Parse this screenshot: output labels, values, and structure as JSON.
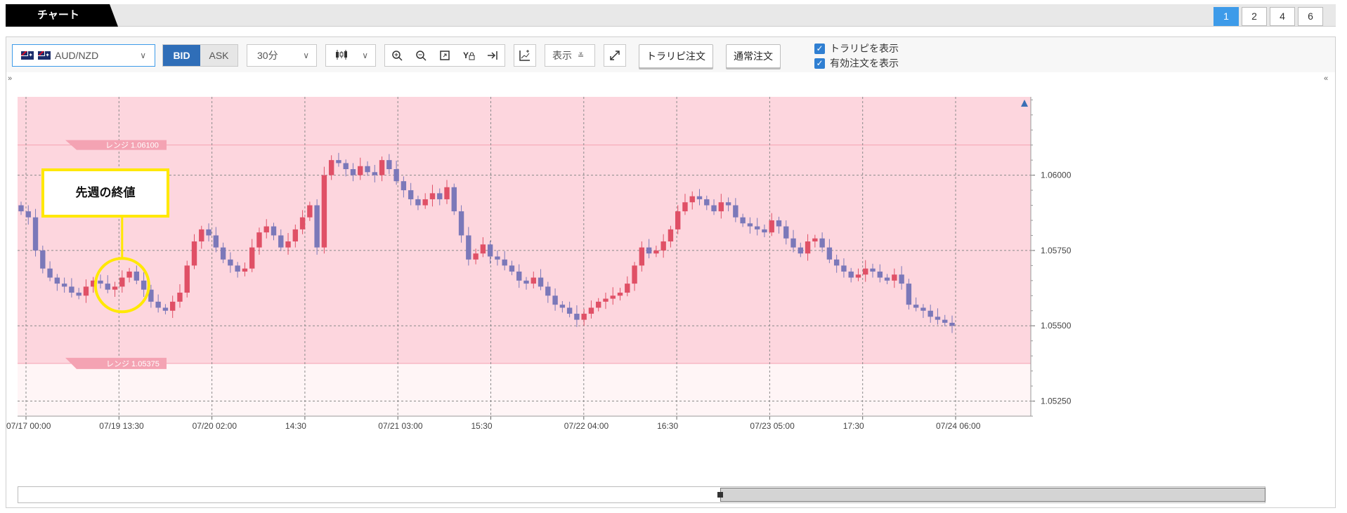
{
  "title_tab": "チャート",
  "layouts": [
    "1",
    "2",
    "4",
    "6"
  ],
  "toolbar": {
    "symbol": "AUD/NZD",
    "bid": "BID",
    "ask": "ASK",
    "period": "30分",
    "display_label": "表示",
    "trarepi_order": "トラリピ注文",
    "normal_order": "通常注文",
    "show_trarepi": "トラリピを表示",
    "show_valid_orders": "有効注文を表示"
  },
  "icons": {
    "zoom_in": "zoom-in-icon",
    "zoom_out": "zoom-out-icon",
    "fit": "fit-icon",
    "y_lock": "y-lock-icon",
    "scroll_end": "scroll-end-icon",
    "indicator": "indicator-icon",
    "fullscreen": "fullscreen-icon"
  },
  "annotation": "先週の終値",
  "range_labels": {
    "upper": "レンジ 1.06100",
    "lower": "レンジ 1.05375"
  },
  "colors": {
    "up": "#e05066",
    "down": "#7b78b9",
    "range_band": "#fde0e6",
    "accent": "#3d9be9"
  },
  "chart_data": {
    "type": "candlestick",
    "symbol": "AUD/NZD",
    "timeframe": "30分",
    "y_ticks": [
      "1.06000",
      "1.05750",
      "1.05500",
      "1.05250"
    ],
    "y_values": [
      1.06,
      1.0575,
      1.055,
      1.0525
    ],
    "ylim": [
      1.052,
      1.0626
    ],
    "x_ticks": [
      "07/17 00:00",
      "07/19 13:30",
      "07/20 02:00",
      "14:30",
      "07/21 03:00",
      "15:30",
      "07/22 04:00",
      "16:30",
      "07/23 05:00",
      "17:30",
      "07/24 06:00"
    ],
    "range": {
      "upper": 1.061,
      "lower": 1.05375
    },
    "closes": [
      1.0588,
      1.0586,
      1.0575,
      1.0569,
      1.0566,
      1.0564,
      1.0563,
      1.0561,
      1.056,
      1.0563,
      1.0565,
      1.0564,
      1.0562,
      1.0563,
      1.0566,
      1.0568,
      1.0565,
      1.0562,
      1.0558,
      1.0556,
      1.0555,
      1.0558,
      1.0561,
      1.057,
      1.0578,
      1.0582,
      1.058,
      1.0576,
      1.0572,
      1.057,
      1.0568,
      1.0569,
      1.0576,
      1.0581,
      1.0583,
      1.058,
      1.0576,
      1.0578,
      1.0582,
      1.0586,
      1.059,
      1.0576,
      1.06,
      1.0605,
      1.0604,
      1.0602,
      1.06,
      1.0603,
      1.0601,
      1.06,
      1.0605,
      1.0602,
      1.0598,
      1.0595,
      1.0592,
      1.059,
      1.0592,
      1.0594,
      1.0592,
      1.0596,
      1.0588,
      1.058,
      1.0572,
      1.0574,
      1.0577,
      1.0573,
      1.0572,
      1.057,
      1.0568,
      1.0565,
      1.0564,
      1.0566,
      1.0563,
      1.056,
      1.0557,
      1.0556,
      1.0554,
      1.0552,
      1.0554,
      1.0556,
      1.0558,
      1.0559,
      1.056,
      1.0561,
      1.0564,
      1.057,
      1.0576,
      1.0574,
      1.0575,
      1.0578,
      1.0582,
      1.0588,
      1.0591,
      1.0593,
      1.0592,
      1.059,
      1.0588,
      1.0591,
      1.059,
      1.0586,
      1.0584,
      1.0583,
      1.0582,
      1.0581,
      1.0585,
      1.0583,
      1.0579,
      1.0576,
      1.0574,
      1.0578,
      1.0579,
      1.0576,
      1.0572,
      1.057,
      1.0568,
      1.0566,
      1.0567,
      1.0569,
      1.0568,
      1.0566,
      1.0565,
      1.0567,
      1.0564,
      1.0557,
      1.0556,
      1.0555,
      1.0553,
      1.0552,
      1.0551,
      1.055
    ]
  }
}
